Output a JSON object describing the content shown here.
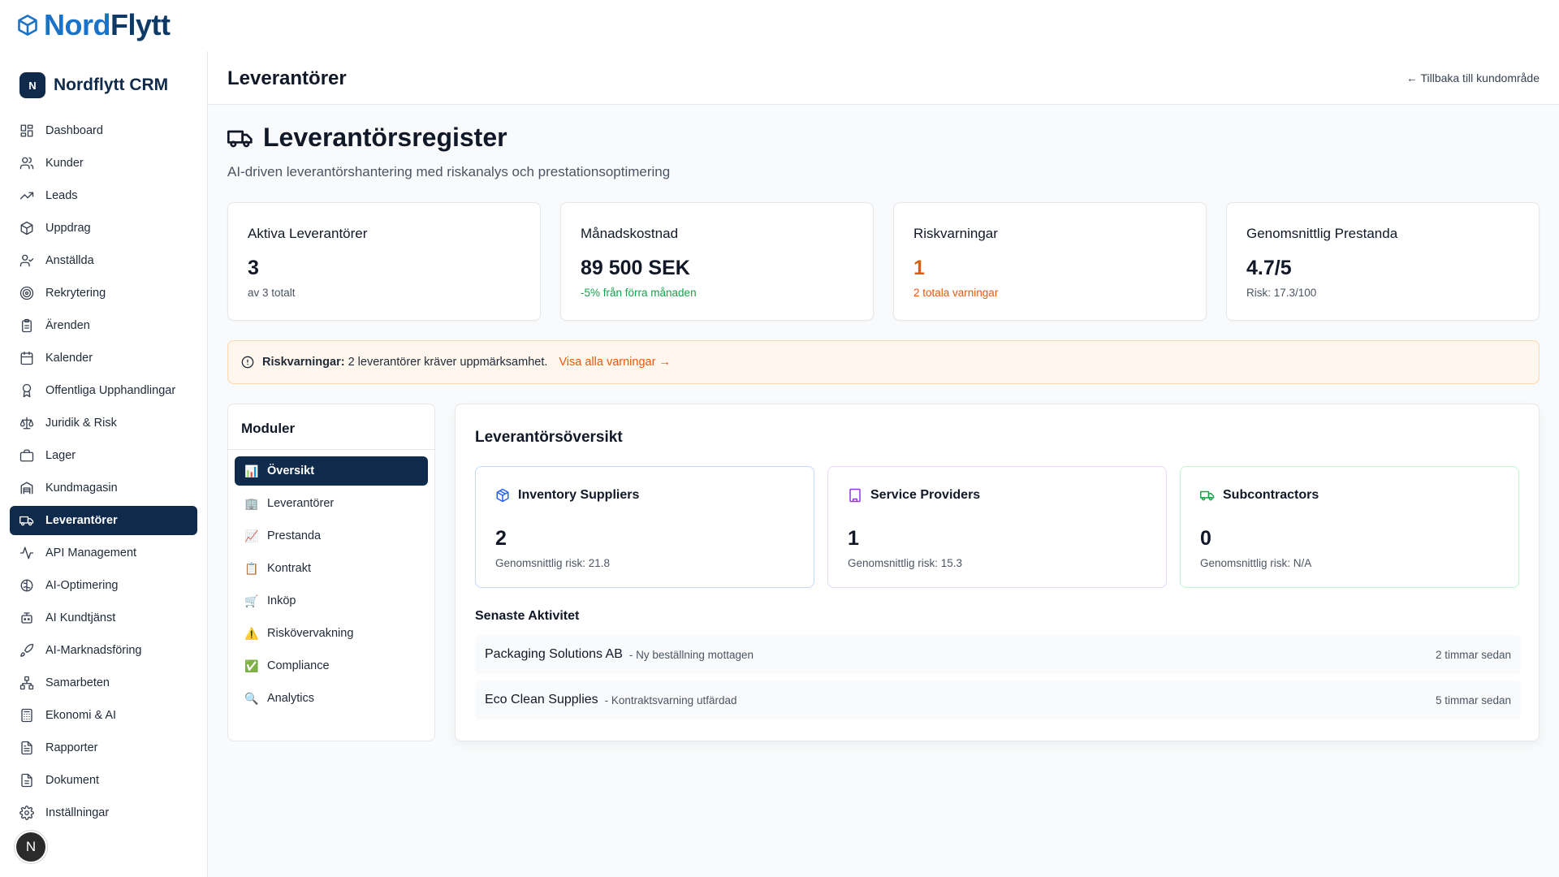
{
  "logo": {
    "part1": "Nord",
    "part2": "Flytt"
  },
  "brand": {
    "badge": "N",
    "name": "Nordflytt CRM"
  },
  "sidebar": {
    "items": [
      {
        "label": "Dashboard",
        "icon": "dashboard-icon"
      },
      {
        "label": "Kunder",
        "icon": "users-icon"
      },
      {
        "label": "Leads",
        "icon": "trending-up-icon"
      },
      {
        "label": "Uppdrag",
        "icon": "package-icon"
      },
      {
        "label": "Anställda",
        "icon": "user-check-icon"
      },
      {
        "label": "Rekrytering",
        "icon": "target-icon"
      },
      {
        "label": "Ärenden",
        "icon": "clipboard-icon"
      },
      {
        "label": "Kalender",
        "icon": "calendar-icon"
      },
      {
        "label": "Offentliga Upphandlingar",
        "icon": "award-icon"
      },
      {
        "label": "Juridik & Risk",
        "icon": "scale-icon"
      },
      {
        "label": "Lager",
        "icon": "briefcase-icon"
      },
      {
        "label": "Kundmagasin",
        "icon": "storage-icon"
      },
      {
        "label": "Leverantörer",
        "icon": "truck-icon"
      },
      {
        "label": "API Management",
        "icon": "activity-icon"
      },
      {
        "label": "AI-Optimering",
        "icon": "brain-icon"
      },
      {
        "label": "AI Kundtjänst",
        "icon": "bot-icon"
      },
      {
        "label": "AI-Marknadsföring",
        "icon": "rocket-icon"
      },
      {
        "label": "Samarbeten",
        "icon": "network-icon"
      },
      {
        "label": "Ekonomi & AI",
        "icon": "calculator-icon"
      },
      {
        "label": "Rapporter",
        "icon": "report-icon"
      },
      {
        "label": "Dokument",
        "icon": "document-icon"
      },
      {
        "label": "Inställningar",
        "icon": "settings-icon"
      }
    ],
    "active_index": 12,
    "avatar": "N"
  },
  "header": {
    "title": "Leverantörer",
    "back_link": "← Tillbaka till kundområde"
  },
  "hero": {
    "title": "Leverantörsregister",
    "subtitle": "AI-driven leverantörshantering med riskanalys och prestationsoptimering"
  },
  "stats": [
    {
      "label": "Aktiva Leverantörer",
      "value": "3",
      "note": "av 3 totalt",
      "tone": "default"
    },
    {
      "label": "Månadskostnad",
      "value": "89 500 SEK",
      "note": "-5% från förra månaden",
      "tone": "green"
    },
    {
      "label": "Riskvarningar",
      "value": "1",
      "note": "2 totala varningar",
      "tone": "orange"
    },
    {
      "label": "Genomsnittlig Prestanda",
      "value": "4.7/5",
      "note": "Risk: 17.3/100",
      "tone": "default"
    }
  ],
  "alert": {
    "bold": "Riskvarningar:",
    "text": "2 leverantörer kräver uppmärksamhet.",
    "link": "Visa alla varningar →"
  },
  "modules": {
    "title": "Moduler",
    "items": [
      {
        "emoji": "📊",
        "label": "Översikt"
      },
      {
        "emoji": "🏢",
        "label": "Leverantörer"
      },
      {
        "emoji": "📈",
        "label": "Prestanda"
      },
      {
        "emoji": "📋",
        "label": "Kontrakt"
      },
      {
        "emoji": "🛒",
        "label": "Inköp"
      },
      {
        "emoji": "⚠️",
        "label": "Riskövervakning"
      },
      {
        "emoji": "✅",
        "label": "Compliance"
      },
      {
        "emoji": "🔍",
        "label": "Analytics"
      }
    ]
  },
  "overview": {
    "title": "Leverantörsöversikt",
    "categories": [
      {
        "name": "Inventory Suppliers",
        "count": "2",
        "risk": "Genomsnittlig risk: 21.8",
        "color": "#2563eb"
      },
      {
        "name": "Service Providers",
        "count": "1",
        "risk": "Genomsnittlig risk: 15.3",
        "color": "#9333ea"
      },
      {
        "name": "Subcontractors",
        "count": "0",
        "risk": "Genomsnittlig risk: N/A",
        "color": "#16a34a"
      }
    ],
    "recent_title": "Senaste Aktivitet",
    "activities": [
      {
        "name": "Packaging Solutions AB",
        "desc": "- Ny beställning mottagen",
        "time": "2 timmar sedan"
      },
      {
        "name": "Eco Clean Supplies",
        "desc": "- Kontraktsvarning utfärdad",
        "time": "5 timmar sedan"
      }
    ]
  }
}
